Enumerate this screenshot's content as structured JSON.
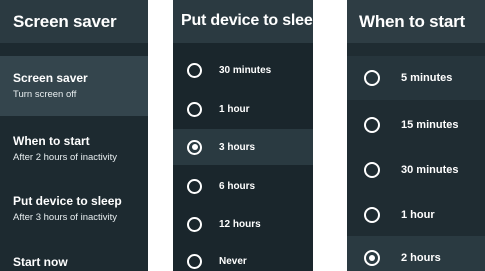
{
  "screen_saver_panel": {
    "title": "Screen saver",
    "items": [
      {
        "title": "Screen saver",
        "subtitle": "Turn screen off"
      },
      {
        "title": "When to start",
        "subtitle": "After 2 hours of inactivity"
      },
      {
        "title": "Put device to sleep",
        "subtitle": "After 3 hours of inactivity"
      },
      {
        "title": "Start now",
        "subtitle": ""
      }
    ]
  },
  "sleep_panel": {
    "title": "Put device to sleep",
    "options": [
      "30 minutes",
      "1 hour",
      "3 hours",
      "6 hours",
      "12 hours",
      "Never"
    ],
    "selected": "3 hours"
  },
  "start_panel": {
    "title": "When to start",
    "options": [
      "5 minutes",
      "15 minutes",
      "30 minutes",
      "1 hour",
      "2 hours"
    ],
    "selected": "2 hours"
  },
  "colors": {
    "panel_bg": "#1d2a30",
    "header_bg": "#2b3a41",
    "highlight_bg": "#34454d",
    "text": "#ffffff"
  }
}
